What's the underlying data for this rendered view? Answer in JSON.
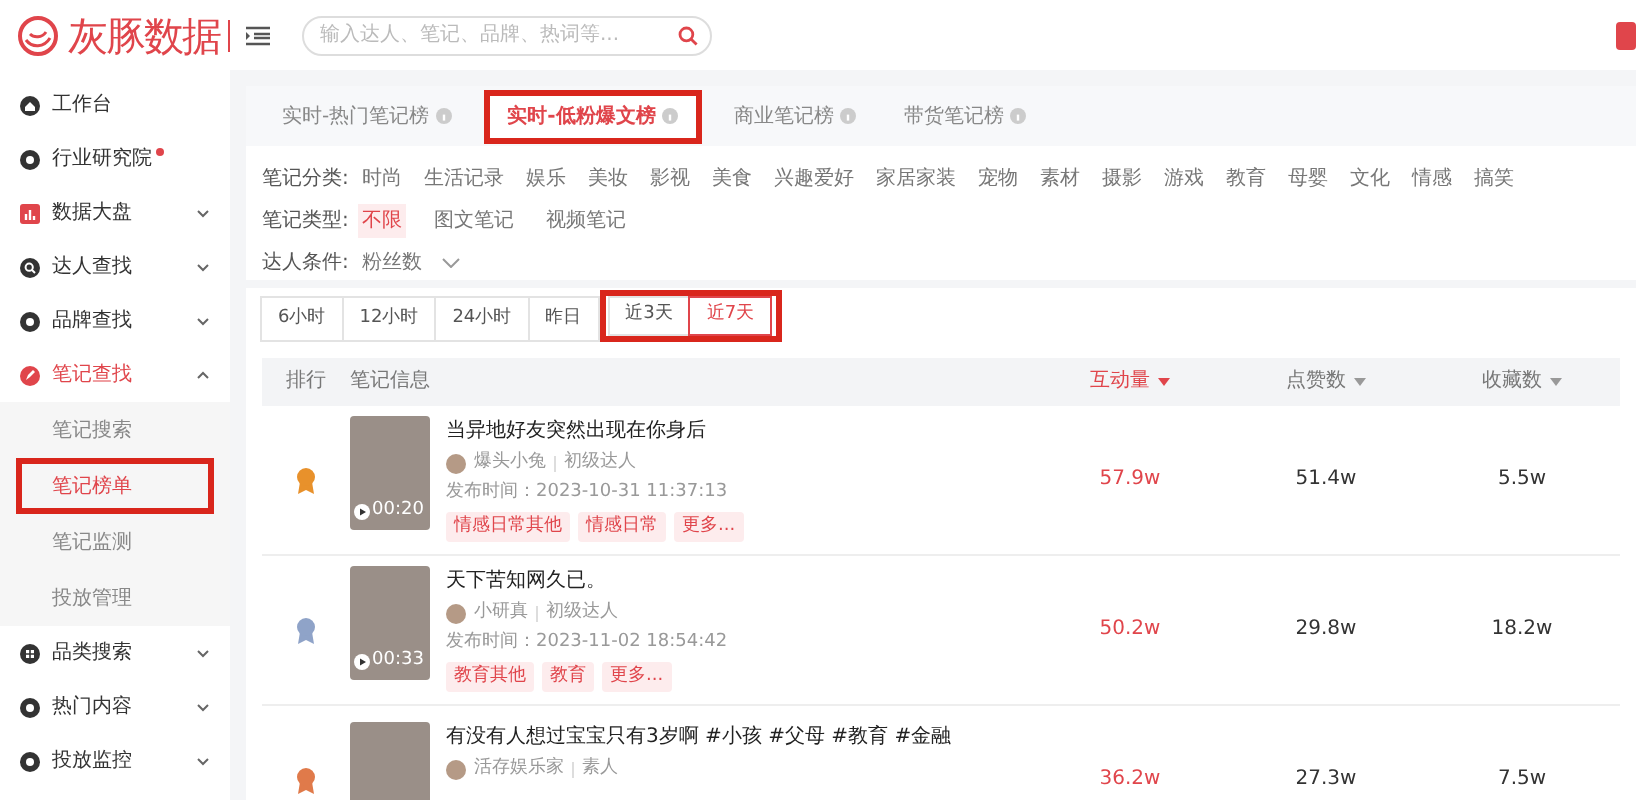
{
  "logo": {
    "text": "灰豚数据"
  },
  "search": {
    "placeholder": "输入达人、笔记、品牌、热词等..."
  },
  "sidebar": {
    "items": [
      {
        "label": "工作台",
        "dot": false,
        "selected": false
      },
      {
        "label": "行业研究院",
        "dot": true,
        "selected": false
      },
      {
        "label": "数据大盘",
        "dot": false,
        "selected": false,
        "expanded": false
      },
      {
        "label": "达人查找",
        "dot": false,
        "selected": false,
        "expanded": false
      },
      {
        "label": "品牌查找",
        "dot": false,
        "selected": false,
        "expanded": false
      },
      {
        "label": "笔记查找",
        "dot": false,
        "selected": true,
        "expanded": true,
        "children": [
          {
            "label": "笔记搜索",
            "selected": false,
            "annotated": false
          },
          {
            "label": "笔记榜单",
            "selected": true,
            "annotated": true
          },
          {
            "label": "笔记监测",
            "selected": false,
            "annotated": false
          },
          {
            "label": "投放管理",
            "selected": false,
            "annotated": false
          }
        ]
      },
      {
        "label": "品类搜索",
        "dot": false,
        "selected": false,
        "expanded": false
      },
      {
        "label": "热门内容",
        "dot": false,
        "selected": false,
        "expanded": false
      },
      {
        "label": "投放监控",
        "dot": false,
        "selected": false,
        "expanded": false
      }
    ]
  },
  "tabs": [
    {
      "label": "实时-热门笔记榜",
      "selected": false,
      "annotated": false
    },
    {
      "label": "实时-低粉爆文榜",
      "selected": true,
      "annotated": true
    },
    {
      "label": "商业笔记榜",
      "selected": false,
      "annotated": false
    },
    {
      "label": "带货笔记榜",
      "selected": false,
      "annotated": false
    }
  ],
  "filters": [
    {
      "label": "笔记分类:",
      "kind": "options",
      "options": [
        {
          "label": "时尚",
          "selected": false
        },
        {
          "label": "生活记录",
          "selected": false
        },
        {
          "label": "娱乐",
          "selected": false
        },
        {
          "label": "美妆",
          "selected": false
        },
        {
          "label": "影视",
          "selected": false
        },
        {
          "label": "美食",
          "selected": false
        },
        {
          "label": "兴趣爱好",
          "selected": false
        },
        {
          "label": "家居家装",
          "selected": false
        },
        {
          "label": "宠物",
          "selected": false
        },
        {
          "label": "素材",
          "selected": false
        },
        {
          "label": "摄影",
          "selected": false
        },
        {
          "label": "游戏",
          "selected": false
        },
        {
          "label": "教育",
          "selected": false
        },
        {
          "label": "母婴",
          "selected": false
        },
        {
          "label": "文化",
          "selected": false
        },
        {
          "label": "情感",
          "selected": false
        },
        {
          "label": "搞笑",
          "selected": false
        }
      ]
    },
    {
      "label": "笔记类型:",
      "kind": "options",
      "options": [
        {
          "label": "不限",
          "selected": true
        },
        {
          "label": "图文笔记",
          "selected": false
        },
        {
          "label": "视频笔记",
          "selected": false
        }
      ]
    },
    {
      "label": "达人条件:",
      "kind": "dropdown",
      "value": "粉丝数"
    }
  ],
  "time_ranges": [
    {
      "label": "6小时",
      "selected": false,
      "annotated": false
    },
    {
      "label": "12小时",
      "selected": false,
      "annotated": false
    },
    {
      "label": "24小时",
      "selected": false,
      "annotated": false
    },
    {
      "label": "昨日",
      "selected": false,
      "annotated": false
    },
    {
      "label": "近3天",
      "selected": false,
      "annotated": true
    },
    {
      "label": "近7天",
      "selected": true,
      "annotated": true
    }
  ],
  "table": {
    "columns": [
      {
        "label": "排行",
        "sortable": false,
        "sorted": false
      },
      {
        "label": "笔记信息",
        "sortable": false,
        "sorted": false
      },
      {
        "label": "互动量",
        "sortable": true,
        "sorted": true
      },
      {
        "label": "点赞数",
        "sortable": true,
        "sorted": false
      },
      {
        "label": "收藏数",
        "sortable": true,
        "sorted": false
      }
    ],
    "rows": [
      {
        "color": "#e8912b",
        "duration": "00:20",
        "title": "当异地好友突然出现在你身后",
        "author": "爆头小兔",
        "level": "初级达人",
        "published": "发布时间：2023-10-31 11:37:13",
        "tags": [
          "情感日常其他",
          "情感日常",
          "更多..."
        ],
        "interactions": "57.9w",
        "likes": "51.4w",
        "favorites": "5.5w"
      },
      {
        "color": "#8fa3c8",
        "duration": "00:33",
        "title": "天下苦知网久已。",
        "author": "小研真",
        "level": "初级达人",
        "published": "发布时间：2023-11-02 18:54:42",
        "tags": [
          "教育其他",
          "教育",
          "更多..."
        ],
        "interactions": "50.2w",
        "likes": "29.8w",
        "favorites": "18.2w"
      },
      {
        "color": "#e07a4a",
        "title": "有没有人想过宝宝只有3岁啊 #小孩 #父母 #教育 #金融",
        "author": "活存娱乐家",
        "level": "素人",
        "interactions": "36.2w",
        "likes": "27.3w",
        "favorites": "7.5w"
      }
    ]
  }
}
